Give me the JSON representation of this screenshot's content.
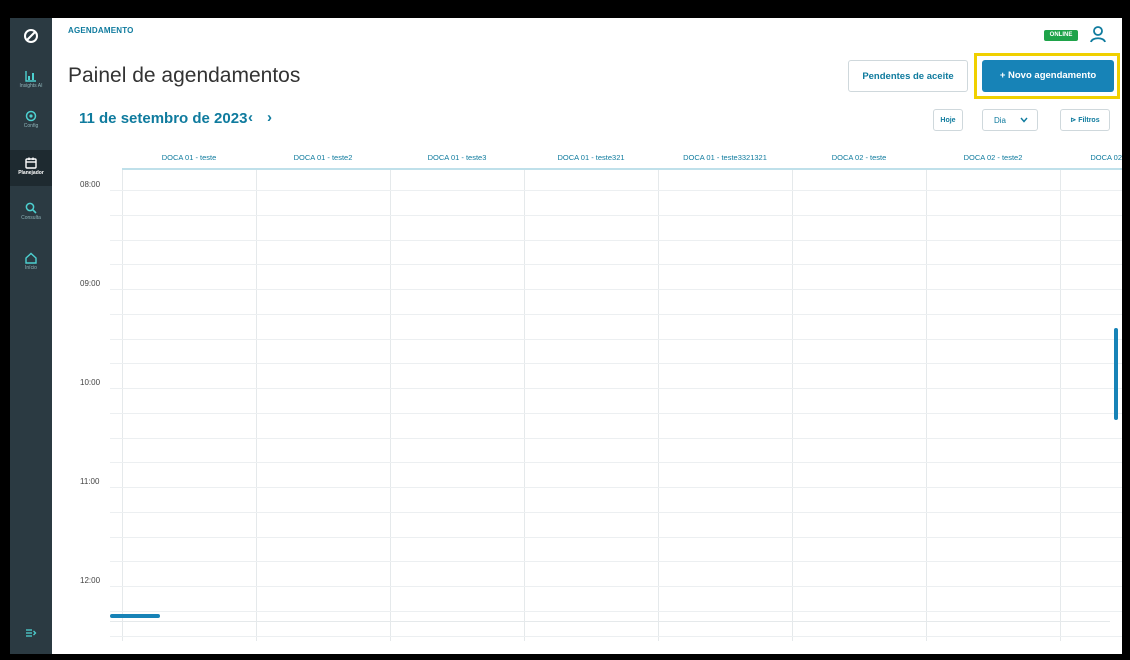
{
  "sidebar": {
    "items": [
      {
        "label": "Insights AI",
        "icon": "chart-icon"
      },
      {
        "label": "Config",
        "icon": "gear-icon"
      },
      {
        "label": "Planejador",
        "icon": "calendar-icon",
        "active": true
      },
      {
        "label": "Consulta",
        "icon": "search-icon"
      },
      {
        "label": "Início",
        "icon": "home-icon"
      }
    ]
  },
  "header": {
    "breadcrumb": "AGENDAMENTO",
    "status": "ONLINE",
    "title": "Painel de agendamentos",
    "pending_button": "Pendentes de aceite",
    "new_button": "+ Novo agendamento"
  },
  "toolbar": {
    "date": "11 de setembro de 2023",
    "prev": "‹",
    "next": "›",
    "today_button": "Hoje",
    "view_select": "Dia",
    "filters_button": "⊳ Filtros"
  },
  "calendar": {
    "columns": [
      "DOCA 01 - teste",
      "DOCA 01 - teste2",
      "DOCA 01 - teste3",
      "DOCA 01 - teste321",
      "DOCA 01 - teste3321321",
      "DOCA 02 - teste",
      "DOCA 02 - teste2",
      "DOCA 02"
    ],
    "times": [
      "08:00",
      "09:00",
      "10:00",
      "11:00",
      "12:00"
    ]
  },
  "colors": {
    "accent": "#0f7b9e",
    "primary_button": "#1783b7",
    "sidebar": "#2b3a42",
    "online": "#1fa34a",
    "highlight": "#f0d000"
  }
}
